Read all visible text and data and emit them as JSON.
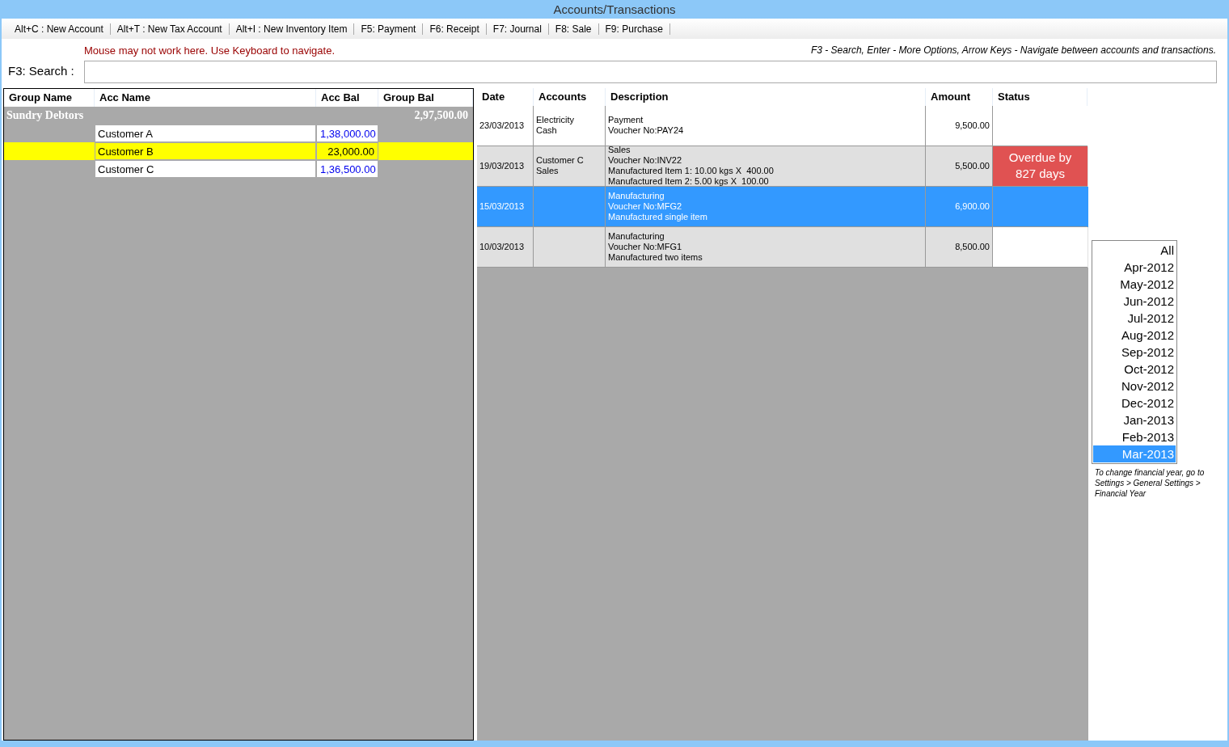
{
  "window": {
    "title": "Accounts/Transactions"
  },
  "toolbar": [
    "Alt+C : New Account",
    "Alt+T : New Tax Account",
    "Alt+I : New Inventory Item",
    "F5: Payment",
    "F6: Receipt",
    "F7: Journal",
    "F8: Sale",
    "F9: Purchase"
  ],
  "warning": "Mouse may not work here. Use Keyboard to navigate.",
  "help": "F3 - Search, Enter - More Options, Arrow Keys - Navigate between accounts and transactions.",
  "search": {
    "label": "F3: Search :"
  },
  "accounts": {
    "columns": [
      "Group Name",
      "Acc Name",
      "Acc Bal",
      "Group Bal"
    ],
    "groups": [
      {
        "name": "Sundry Debtors",
        "balance": "2,97,500.00",
        "accounts": [
          {
            "name": "Customer A",
            "balance": "1,38,000.00",
            "selected": false
          },
          {
            "name": "Customer B",
            "balance": "23,000.00",
            "selected": true
          },
          {
            "name": "Customer C",
            "balance": "1,36,500.00",
            "selected": false
          }
        ]
      }
    ]
  },
  "transactions": {
    "columns": [
      "Date",
      "Accounts",
      "Description",
      "Amount",
      "Status"
    ],
    "rows": [
      {
        "date": "23/03/2013",
        "accounts": [
          "Electricity",
          "Cash"
        ],
        "description": [
          "Payment",
          "Voucher No:PAY24"
        ],
        "amount": "9,500.00",
        "shaded": false,
        "selected": false
      },
      {
        "date": "19/03/2013",
        "accounts": [
          "Customer C",
          "Sales"
        ],
        "description": [
          "Sales",
          "Voucher No:INV22",
          "Manufactured Item 1: 10.00 kgs X  400.00",
          "Manufactured Item 2: 5.00 kgs X  100.00"
        ],
        "amount": "5,500.00",
        "shaded": true,
        "selected": false,
        "status": {
          "text": "Overdue by 827 days",
          "color": "#e05252"
        }
      },
      {
        "date": "15/03/2013",
        "accounts": [],
        "description": [
          "Manufacturing",
          "Voucher No:MFG2",
          "Manufactured single item"
        ],
        "amount": "6,900.00",
        "selected": true
      },
      {
        "date": "10/03/2013",
        "accounts": [],
        "description": [
          "Manufacturing",
          "Voucher No:MFG1",
          "Manufactured two items"
        ],
        "amount": "8,500.00",
        "shaded": true,
        "selected": false
      }
    ]
  },
  "months": [
    {
      "label": "All",
      "selected": false
    },
    {
      "label": "Apr-2012",
      "selected": false
    },
    {
      "label": "May-2012",
      "selected": false
    },
    {
      "label": "Jun-2012",
      "selected": false
    },
    {
      "label": "Jul-2012",
      "selected": false
    },
    {
      "label": "Aug-2012",
      "selected": false
    },
    {
      "label": "Sep-2012",
      "selected": false
    },
    {
      "label": "Oct-2012",
      "selected": false
    },
    {
      "label": "Nov-2012",
      "selected": false
    },
    {
      "label": "Dec-2012",
      "selected": false
    },
    {
      "label": "Jan-2013",
      "selected": false
    },
    {
      "label": "Feb-2013",
      "selected": false
    },
    {
      "label": "Mar-2013",
      "selected": true
    }
  ],
  "financial_year_note": "To change financial year, go to Settings > General Settings > Financial Year"
}
